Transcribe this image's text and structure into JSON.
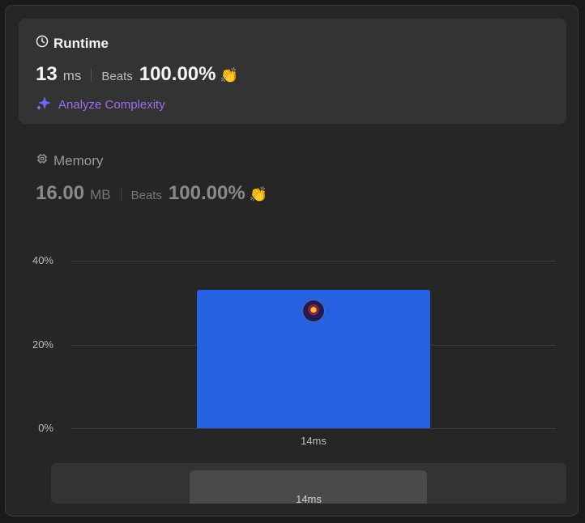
{
  "runtime": {
    "title": "Runtime",
    "value": "13",
    "unit": "ms",
    "beats_label": "Beats",
    "beats_pct": "100.00%",
    "analyze_label": "Analyze Complexity"
  },
  "memory": {
    "title": "Memory",
    "value": "16.00",
    "unit": "MB",
    "beats_label": "Beats",
    "beats_pct": "100.00%"
  },
  "icons": {
    "runtime": "clock-icon",
    "memory": "chip-icon",
    "clap": "clapping-hands-icon",
    "analyze": "sparkle-icon"
  },
  "colors": {
    "accent_bar": "#2561e0",
    "analyze_text": "#a06cf0",
    "clap": "#43a047"
  },
  "chart_data": {
    "type": "bar",
    "categories": [
      "14ms"
    ],
    "values": [
      33
    ],
    "yticks": [
      "0%",
      "20%",
      "40%"
    ],
    "ylim": [
      0,
      40
    ],
    "xlabel": "",
    "ylabel": ""
  },
  "mini_chart": {
    "label": "14ms"
  }
}
